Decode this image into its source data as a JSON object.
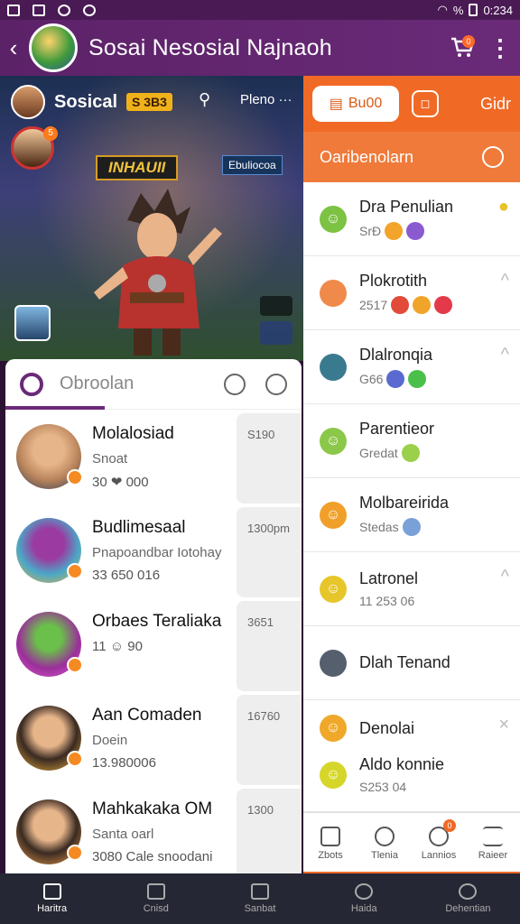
{
  "status_bar": {
    "battery_text": "%",
    "time": "0:234"
  },
  "app_bar": {
    "title": "Sosai Nesosial Najnaoh",
    "cart_count": "0"
  },
  "hero": {
    "title": "Sosical",
    "chip": "S 3B3",
    "menu_label": "Pleno ···",
    "avatar_badge": "5",
    "banner": "INHAUII",
    "tag": "Ebuliocoa"
  },
  "right_panel": {
    "tabs": [
      {
        "label": "Bu00"
      },
      {
        "label": ""
      },
      {
        "label": "Gidr"
      }
    ],
    "header": "Oaribenolarn",
    "items": [
      {
        "name": "Dra Penulian",
        "sub": "SrÐ",
        "icon_color": "#7cc243",
        "chevron": ""
      },
      {
        "name": "Plokrotith",
        "sub": "2517",
        "icon_color": "#f08a4a",
        "chevron": "^"
      },
      {
        "name": "Dlalronqia",
        "sub": "G66",
        "icon_color": "#3a7a8f",
        "chevron": "^"
      },
      {
        "name": "Parentieor",
        "sub": "Gredat",
        "icon_color": "#8bc84a",
        "chevron": ""
      },
      {
        "name": "Molbareirida",
        "sub": "Stedas",
        "icon_color": "#f0a02a",
        "chevron": ""
      },
      {
        "name": "Latronel",
        "sub": "11 253 06",
        "icon_color": "#e6c62a",
        "chevron": "^"
      },
      {
        "name": "Dlah Tenand",
        "sub": "",
        "icon_color": "#555f6e",
        "chevron": ""
      },
      {
        "name": "Denolai",
        "sub": "",
        "icon_color": "#f0a82a",
        "chevron": "×"
      },
      {
        "name": "Aldo konnie",
        "sub": "S253 04",
        "icon_color": "#d6d62a",
        "chevron": ""
      }
    ],
    "bottom": [
      {
        "label": "Zbots"
      },
      {
        "label": "Tlenia",
        "badge": "0"
      },
      {
        "label": "Lannios"
      },
      {
        "label": "Raieer"
      }
    ]
  },
  "chat": {
    "tab_label": "Obroolan",
    "rows": [
      {
        "name": "Molalosiad",
        "sub": "Snoat",
        "meta": "30 ❤ 000",
        "time": "S190",
        "avatar_color": "#b7825a"
      },
      {
        "name": "Budlimesaal",
        "sub": "Pnapoandbar Iotohay",
        "meta": "33 650 016",
        "time": "1300pm",
        "avatar_color": "#4aa8c7"
      },
      {
        "name": "Orbaes Teraliaka",
        "sub": "",
        "meta": "11 ☺ 90",
        "time": "3651",
        "avatar_color": "#9a2f9a"
      },
      {
        "name": "Aan Comaden",
        "sub": "Doein",
        "meta": "13.980006",
        "time": "16760",
        "avatar_color": "#f0b23c"
      },
      {
        "name": "Mahkakaka OM",
        "sub": "Santa oarl",
        "meta": "3080 Cale snoodani",
        "time": "1300",
        "avatar_color": "#f0a04a"
      }
    ]
  },
  "bottom_nav": [
    {
      "label": "Haritra"
    },
    {
      "label": "Cnisd"
    },
    {
      "label": "Sanbat"
    },
    {
      "label": "Haida"
    },
    {
      "label": "Dehentian"
    }
  ]
}
